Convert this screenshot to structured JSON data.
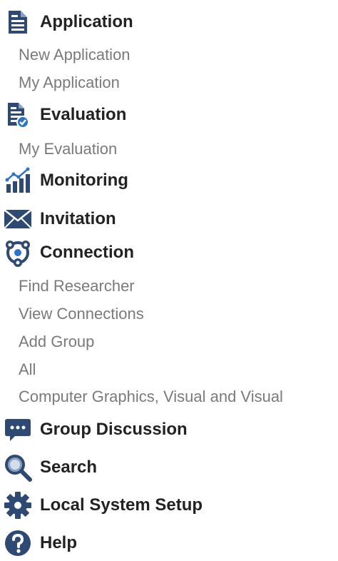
{
  "colors": {
    "icon_primary": "#2e4a74",
    "icon_accent": "#2d74c8",
    "heading_text": "#222222",
    "sub_text": "#7a7a7a"
  },
  "sections": {
    "application": {
      "label": "Application",
      "icon": "document-icon",
      "items": [
        "New Application",
        "My Application"
      ]
    },
    "evaluation": {
      "label": "Evaluation",
      "icon": "evaluation-icon",
      "items": [
        "My Evaluation"
      ]
    },
    "monitoring": {
      "label": "Monitoring",
      "icon": "chart-icon",
      "items": []
    },
    "invitation": {
      "label": "Invitation",
      "icon": "envelope-icon",
      "items": []
    },
    "connection": {
      "label": "Connection",
      "icon": "network-icon",
      "items": [
        "Find Researcher",
        "View Connections",
        "Add Group",
        "All",
        "Computer Graphics, Visual and Visual"
      ]
    },
    "group_discussion": {
      "label": "Group Discussion",
      "icon": "chat-icon",
      "items": []
    },
    "search": {
      "label": "Search",
      "icon": "search-icon",
      "items": []
    },
    "local_system_setup": {
      "label": "Local System Setup",
      "icon": "gear-icon",
      "items": []
    },
    "help": {
      "label": "Help",
      "icon": "help-icon",
      "items": []
    }
  }
}
